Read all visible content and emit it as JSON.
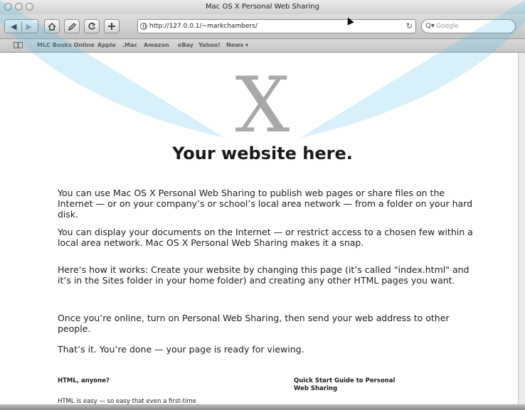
{
  "window": {
    "title": "Mac OS X Personal Web Sharing"
  },
  "toolbar": {
    "back_icon": "back-arrow-icon",
    "forward_icon": "forward-arrow-icon",
    "home_icon": "home-icon",
    "edit_icon": "edit-icon",
    "reload_icon": "reload-icon",
    "add_icon": "plus-icon",
    "url": "http://127.0.0.1/~markchambers/",
    "search_placeholder": "Google"
  },
  "bookmarks": [
    "MLC Books Online",
    "Apple",
    ".Mac",
    "Amazon",
    "eBay",
    "Yahoo!",
    "News ▾"
  ],
  "page": {
    "logo": "X",
    "headline": "Your website here.",
    "paragraphs": [
      "You can use Mac OS X Personal Web Sharing to publish web pages or share files on the Internet — or on your company’s or school’s local area network — from a folder on your hard disk.",
      "You can display your documents on the Internet — or restrict access to a chosen few within a local area network. Mac OS X Personal Web Sharing makes it a snap.",
      "Here’s how it works: Create your website by changing this page (it’s called \"index.html\" and it’s in the Sites folder in your home folder) and creating any other HTML pages you want.",
      "Once you’re online, turn on Personal Web Sharing, then send your web address to other people.",
      "That’s it. You’re done — your page is ready for viewing."
    ],
    "left_heading": "HTML, anyone?",
    "left_text": "HTML is easy — so easy that even a first-time",
    "right_heading": "Quick Start Guide to Personal Web Sharing"
  },
  "colors": {
    "overlay_arc": "#4fb9e8"
  }
}
